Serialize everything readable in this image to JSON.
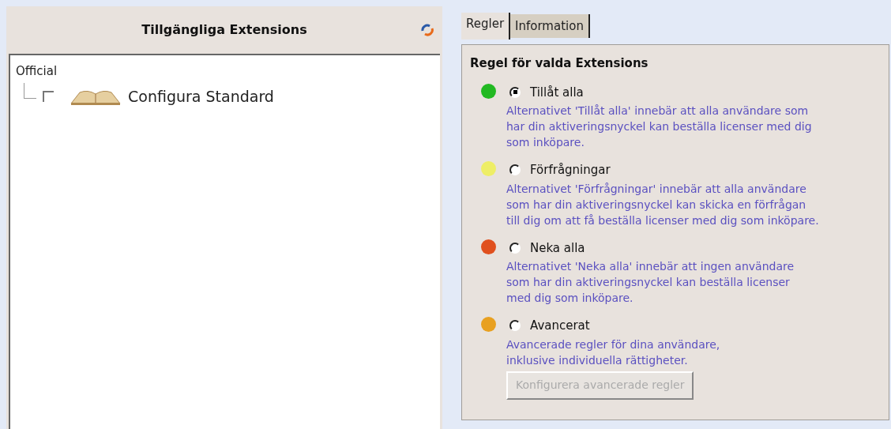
{
  "left_panel": {
    "title": "Tillgängliga Extensions",
    "tree": [
      {
        "label": "Official",
        "children": [
          {
            "label": "Configura Standard",
            "checked": false
          }
        ]
      }
    ]
  },
  "tabs": [
    {
      "label": "Regler",
      "selected": true
    },
    {
      "label": "Information",
      "selected": false
    }
  ],
  "rules": {
    "title": "Regel för valda Extensions",
    "options": [
      {
        "label": "Tillåt alla",
        "selected": true,
        "color": "#22b922",
        "description_lines": [
          "Alternativet 'Tillåt alla' innebär att alla användare som",
          "har din aktiveringsnyckel kan beställa licenser med dig",
          "som inköpare."
        ]
      },
      {
        "label": "Förfrågningar",
        "selected": false,
        "color": "#eeee66",
        "description_lines": [
          "Alternativet 'Förfrågningar' innebär att alla användare",
          "som har din aktiveringsnyckel kan skicka en förfrågan",
          "till dig om att få beställa licenser med dig som inköpare."
        ]
      },
      {
        "label": "Neka alla",
        "selected": false,
        "color": "#e0501e",
        "description_lines": [
          "Alternativet 'Neka alla' innebär att ingen användare",
          "som har din aktiveringsnyckel kan beställa licenser",
          "med dig som inköpare."
        ]
      },
      {
        "label": "Avancerat",
        "selected": false,
        "color": "#e8a020",
        "description_lines": [
          "Avancerade regler för dina användare,",
          "inklusive individuella rättigheter."
        ],
        "button": {
          "label": "Konfigurera avancerade regler",
          "disabled": true
        }
      }
    ]
  }
}
